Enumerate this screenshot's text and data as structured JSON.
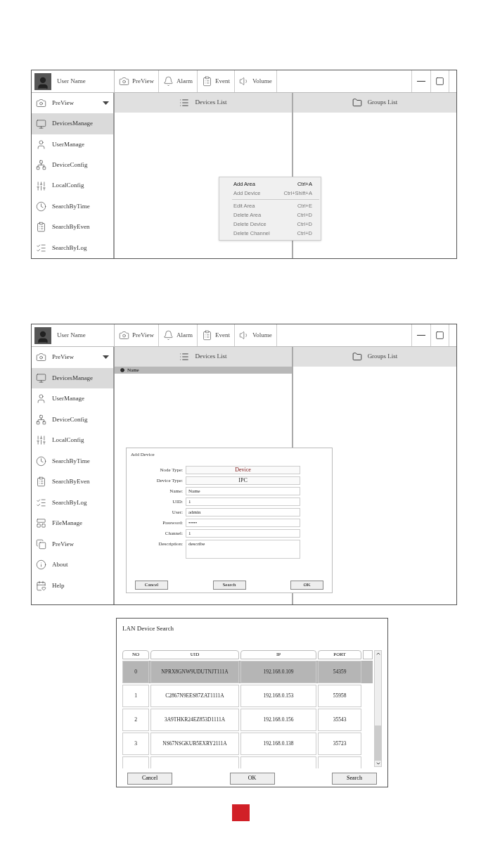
{
  "windows": [
    {
      "user": {
        "name": "User Name"
      },
      "toolbar": [
        {
          "label": "PreView"
        },
        {
          "label": "Alarm"
        },
        {
          "label": "Event"
        },
        {
          "label": "Volume"
        }
      ],
      "sidebar": [
        {
          "label": "PreView",
          "kind": "dropdown",
          "selected": false
        },
        {
          "label": "DevicesManage",
          "kind": "item",
          "selected": true
        },
        {
          "label": "UserManage",
          "kind": "item",
          "selected": false
        },
        {
          "label": "DeviceConfig",
          "kind": "item",
          "selected": false
        },
        {
          "label": "LocalConfig",
          "kind": "item",
          "selected": false
        },
        {
          "label": "SearchByTime",
          "kind": "item",
          "selected": false
        },
        {
          "label": "SearchByEven",
          "kind": "item",
          "selected": false
        },
        {
          "label": "SearchByLog",
          "kind": "item",
          "selected": false
        }
      ],
      "panes": [
        {
          "title": "Devices List",
          "kind": "devices"
        },
        {
          "title": "Groups List",
          "kind": "groups"
        }
      ],
      "context_menu": {
        "items": [
          {
            "kind": "item",
            "label": "Add Area",
            "shortcut": "Ctrl+A",
            "disabled": false
          },
          {
            "kind": "item",
            "label": "Add Device",
            "shortcut": "Ctrl+Shift+A",
            "disabled": true
          },
          {
            "kind": "separator"
          },
          {
            "kind": "item",
            "label": "Edit Area",
            "shortcut": "Ctrl+E",
            "disabled": true
          },
          {
            "kind": "item",
            "label": "Delete Area",
            "shortcut": "Ctrl+D",
            "disabled": true
          },
          {
            "kind": "item",
            "label": "Delete Device",
            "shortcut": "Ctrl+D",
            "disabled": true
          },
          {
            "kind": "item",
            "label": "Delete Channel",
            "shortcut": "Ctrl+D",
            "disabled": true
          }
        ]
      }
    },
    {
      "user": {
        "name": "User Name"
      },
      "toolbar": [
        {
          "label": "PreView"
        },
        {
          "label": "Alarm"
        },
        {
          "label": "Event"
        },
        {
          "label": "Volume"
        }
      ],
      "sidebar": [
        {
          "label": "PreView",
          "kind": "dropdown",
          "selected": false
        },
        {
          "label": "DevicesManage",
          "kind": "item",
          "selected": true
        },
        {
          "label": "UserManage",
          "kind": "item",
          "selected": false
        },
        {
          "label": "DeviceConfig",
          "kind": "item",
          "selected": false
        },
        {
          "label": "LocalConfig",
          "kind": "item",
          "selected": false
        },
        {
          "label": "SearchByTime",
          "kind": "item",
          "selected": false
        },
        {
          "label": "SearchByEven",
          "kind": "item",
          "selected": false
        },
        {
          "label": "SearchByLog",
          "kind": "item",
          "selected": false
        },
        {
          "label": "FileManage",
          "kind": "item",
          "selected": false
        },
        {
          "label": "PreView",
          "kind": "item",
          "selected": false
        },
        {
          "label": "About",
          "kind": "item",
          "selected": false
        },
        {
          "label": "Help",
          "kind": "item",
          "selected": false
        }
      ],
      "panes": [
        {
          "title": "Devices List",
          "kind": "devices"
        },
        {
          "title": "Groups List",
          "kind": "groups"
        }
      ],
      "device_tree": [
        {
          "label": "Name",
          "selected": true
        }
      ],
      "dialog": {
        "title": "Add Device",
        "fields": [
          {
            "label": "Node Type:",
            "kind": "select",
            "value": "Device"
          },
          {
            "label": "Device Type:",
            "kind": "select",
            "value": "IPC"
          },
          {
            "label": "Name:",
            "kind": "text",
            "value": "Name"
          },
          {
            "label": "UID:",
            "kind": "text",
            "value": "1"
          },
          {
            "label": "User:",
            "kind": "text",
            "value": "admin"
          },
          {
            "label": "Password:",
            "kind": "text",
            "value": "•••••"
          },
          {
            "label": "Channel:",
            "kind": "text",
            "value": "1"
          },
          {
            "label": "Description:",
            "kind": "textarea",
            "value": "describe"
          }
        ],
        "buttons": [
          "Cancel",
          "Search",
          "OK"
        ]
      }
    }
  ],
  "lan_search": {
    "title": "LAN Device Search",
    "columns": [
      "NO",
      "UID",
      "IP",
      "PORT"
    ],
    "rows": [
      {
        "cells": [
          "0",
          "NPRX8GNW9UDUTNJT111A",
          "192.168.0.109",
          "54359"
        ],
        "selected": true
      },
      {
        "cells": [
          "1",
          "C2867N9EES87ZAT1111A",
          "192.168.0.153",
          "55958"
        ],
        "selected": false
      },
      {
        "cells": [
          "2",
          "3A9THKR24EZ853D1111A",
          "192.168.0.156",
          "35543"
        ],
        "selected": false
      },
      {
        "cells": [
          "3",
          "NS67NSGKUB5EXRY2111A",
          "192.168.0.138",
          "35723"
        ],
        "selected": false
      }
    ],
    "buttons": [
      "Cancel",
      "OK",
      "Search"
    ]
  }
}
